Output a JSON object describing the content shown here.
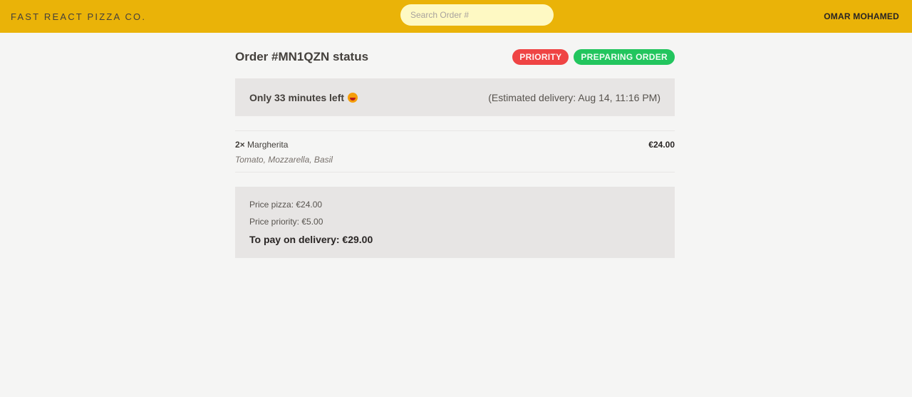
{
  "header": {
    "logo": "Fast React Pizza Co.",
    "search_placeholder": "Search Order #",
    "user": "OMAR MOHAMED"
  },
  "order": {
    "title": "Order #MN1QZN status",
    "badges": {
      "priority": "Priority",
      "status": "Preparing order"
    },
    "eta_left": "Only 33 minutes left",
    "eta_right": "(Estimated delivery: Aug 14, 11:16 PM)",
    "items": [
      {
        "qty": "2×",
        "name": "Margherita",
        "ingredients": "Tomato, Mozzarella, Basil",
        "price": "€24.00"
      }
    ],
    "summary": {
      "price_pizza": "Price pizza: €24.00",
      "price_priority": "Price priority: €5.00",
      "to_pay": "To pay on delivery: €29.00"
    }
  },
  "colors": {
    "header": "#eab308",
    "priority": "#ef4444",
    "status": "#22c55e",
    "panel": "#e7e5e4"
  },
  "icons": {
    "eta_emoji": "grinning-face-icon"
  }
}
